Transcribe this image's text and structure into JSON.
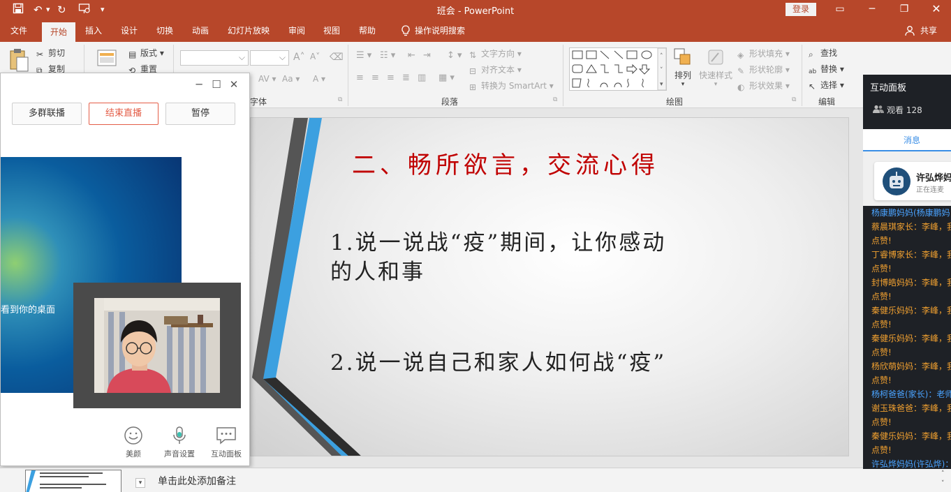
{
  "titlebar": {
    "doc_title": "班会 - PowerPoint",
    "login_label": "登录"
  },
  "colors": {
    "accent": "#b7472a",
    "slide_title": "#c00000",
    "live_end": "#e45d47",
    "panel_blue": "#3a8ee6",
    "msg_orange": "#f0a030",
    "msg_blue": "#4aa3ff"
  },
  "tabs": [
    {
      "label": "文件"
    },
    {
      "label": "开始"
    },
    {
      "label": "插入"
    },
    {
      "label": "设计"
    },
    {
      "label": "切换"
    },
    {
      "label": "动画"
    },
    {
      "label": "幻灯片放映"
    },
    {
      "label": "审阅"
    },
    {
      "label": "视图"
    },
    {
      "label": "帮助"
    },
    {
      "label": "操作说明搜索"
    },
    {
      "label": "共享"
    }
  ],
  "ribbon": {
    "clipboard": {
      "cut": "剪切",
      "copy": "复制"
    },
    "slides": {
      "layout": "版式",
      "reset": "重置"
    },
    "font_label": "字体",
    "paragraph": {
      "label": "段落",
      "text_direction": "文字方向",
      "align_text": "对齐文本",
      "smartart": "转换为 SmartArt"
    },
    "drawing": {
      "label": "绘图",
      "arrange": "排列",
      "quick_styles": "快速样式",
      "fill": "形状填充",
      "outline": "形状轮廓",
      "effects": "形状效果"
    },
    "editing": {
      "label": "编辑",
      "find": "查找",
      "replace": "替换",
      "select": "选择"
    }
  },
  "live": {
    "btn_multi": "多群联播",
    "btn_end": "结束直播",
    "btn_pause": "暂停",
    "desktop_text": "看到你的桌面",
    "tools": [
      {
        "label": "美颜"
      },
      {
        "label": "声音设置"
      },
      {
        "label": "互动面板"
      }
    ]
  },
  "slide": {
    "title": "二、畅所欲言，交流心得",
    "line1a": "1.说一说战“疫”期间，让你感动",
    "line1b": "的人和事",
    "line2": "2.说一说自己和家人如何战“疫”"
  },
  "notes": {
    "placeholder": "单击此处添加备注"
  },
  "panel": {
    "title": "互动面板",
    "viewers": "观看 128",
    "tab": "消息",
    "host_name": "许弘烨妈",
    "host_status": "正在连麦",
    "messages": [
      {
        "text": "杨康鹏妈妈(杨康鹏妈",
        "color": "blue"
      },
      {
        "text": "蔡晨琪家长：李峰，我",
        "color": "orange"
      },
      {
        "text": "点赞!",
        "color": "orange"
      },
      {
        "text": "丁睿博家长：李峰，我",
        "color": "orange"
      },
      {
        "text": "点赞!",
        "color": "orange"
      },
      {
        "text": "封博皓妈妈：李峰，我",
        "color": "orange"
      },
      {
        "text": "点赞!",
        "color": "orange"
      },
      {
        "text": "秦健乐妈妈：李峰，我",
        "color": "orange"
      },
      {
        "text": "点赞!",
        "color": "orange"
      },
      {
        "text": "秦健乐妈妈：李峰，我",
        "color": "orange"
      },
      {
        "text": "点赞!",
        "color": "orange"
      },
      {
        "text": "杨欣萌妈妈：李峰，我",
        "color": "orange"
      },
      {
        "text": "点赞!",
        "color": "orange"
      },
      {
        "text": "杨柯爸爸(家长)：老师",
        "color": "blue"
      },
      {
        "text": "谢玉珠爸爸：李峰，我",
        "color": "orange"
      },
      {
        "text": "点赞!",
        "color": "orange"
      },
      {
        "text": "秦健乐妈妈：李峰，我",
        "color": "orange"
      },
      {
        "text": "点赞!",
        "color": "orange"
      },
      {
        "text": "许弘烨妈妈(许弘烨)：",
        "color": "blue"
      }
    ]
  }
}
